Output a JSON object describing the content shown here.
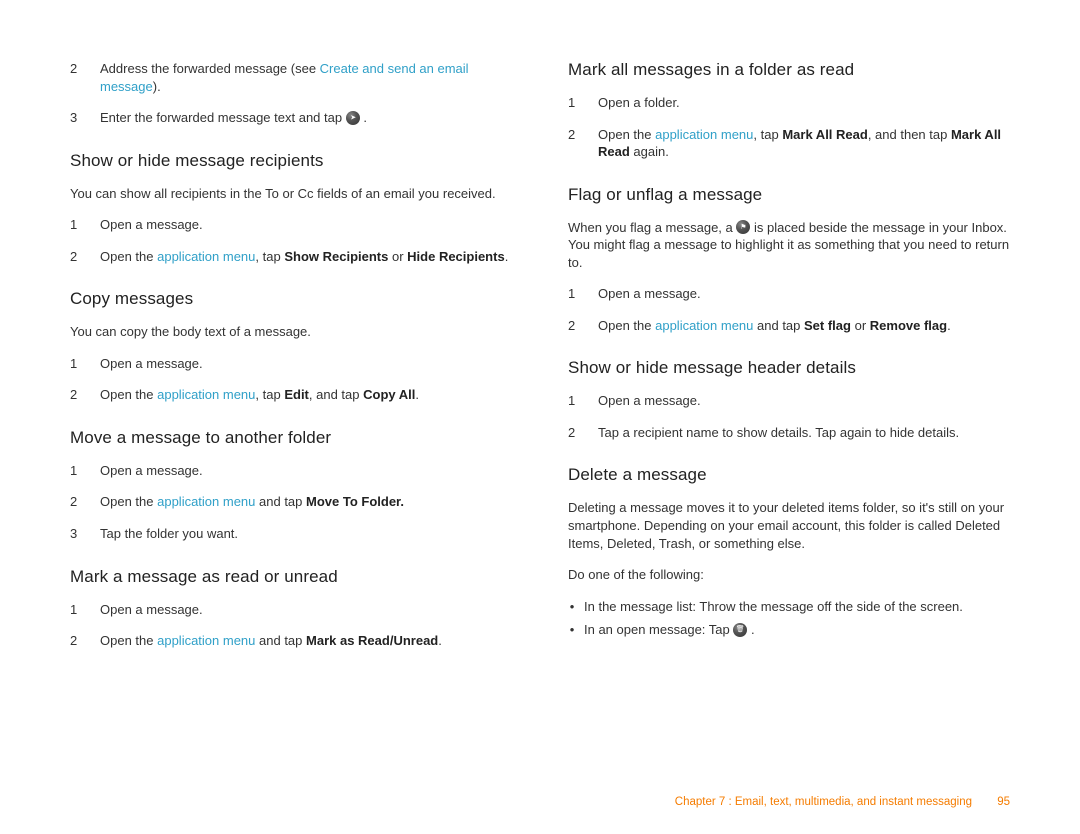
{
  "left": {
    "step2": {
      "pre": "Address the forwarded message (see ",
      "link": "Create and send an email message",
      "post": ")."
    },
    "step3": "Enter the forwarded message text and tap ",
    "h_show": "Show or hide message recipients",
    "p_show": "You can show all recipients in the To or Cc fields of an email you received.",
    "show_s1": "Open a message.",
    "show_s2": {
      "pre": "Open the ",
      "link": "application menu",
      "mid": ", tap ",
      "b1": "Show Recipients",
      "mid2": " or ",
      "b2": "Hide Recipients",
      "post": "."
    },
    "h_copy": "Copy messages",
    "p_copy": "You can copy the body text of a message.",
    "copy_s1": "Open a message.",
    "copy_s2": {
      "pre": "Open the ",
      "link": "application menu",
      "mid": ", tap ",
      "b1": "Edit",
      "mid2": ", and tap ",
      "b2": "Copy All",
      "post": "."
    },
    "h_move": "Move a message to another folder",
    "move_s1": "Open a message.",
    "move_s2": {
      "pre": "Open the ",
      "link": "application menu",
      "mid": " and tap ",
      "b1": "Move To Folder.",
      "post": ""
    },
    "move_s3": "Tap the folder you want.",
    "h_mark": "Mark a message as read or unread",
    "mark_s1": "Open a message.",
    "mark_s2": {
      "pre": "Open the ",
      "link": "application menu",
      "mid": " and tap ",
      "b1": "Mark as Read/Unread",
      "post": "."
    }
  },
  "right": {
    "h_markall": "Mark all messages in a folder as read",
    "ma_s1": "Open a folder.",
    "ma_s2": {
      "pre": "Open the ",
      "link": "application menu",
      "mid": ", tap ",
      "b1": "Mark All Read",
      "mid2": ", and then tap ",
      "b2": "Mark All Read",
      "post": " again."
    },
    "h_flag": "Flag or unflag a message",
    "p_flag_pre": "When you flag a message, a ",
    "p_flag_post": " is placed beside the message in your Inbox. You might flag a message to highlight it as something that you need to return to.",
    "flag_s1": "Open a message.",
    "flag_s2": {
      "pre": "Open the ",
      "link": "application menu",
      "mid": " and tap ",
      "b1": "Set flag",
      "mid2": " or ",
      "b2": "Remove flag",
      "post": "."
    },
    "h_header": "Show or hide message header details",
    "hd_s1": "Open a message.",
    "hd_s2": "Tap a recipient name to show details. Tap again to hide details.",
    "h_delete": "Delete a message",
    "p_delete": "Deleting a message moves it to your deleted items folder, so it's still on your smartphone. Depending on your email account, this folder is called Deleted Items, Deleted, Trash, or something else.",
    "p_do": "Do one of the following:",
    "del_b1": "In the message list: Throw the message off the side of the screen.",
    "del_b2": "In an open message: Tap "
  },
  "footer": {
    "chapter": "Chapter 7 : Email, text, multimedia, and instant messaging",
    "page": "95"
  }
}
